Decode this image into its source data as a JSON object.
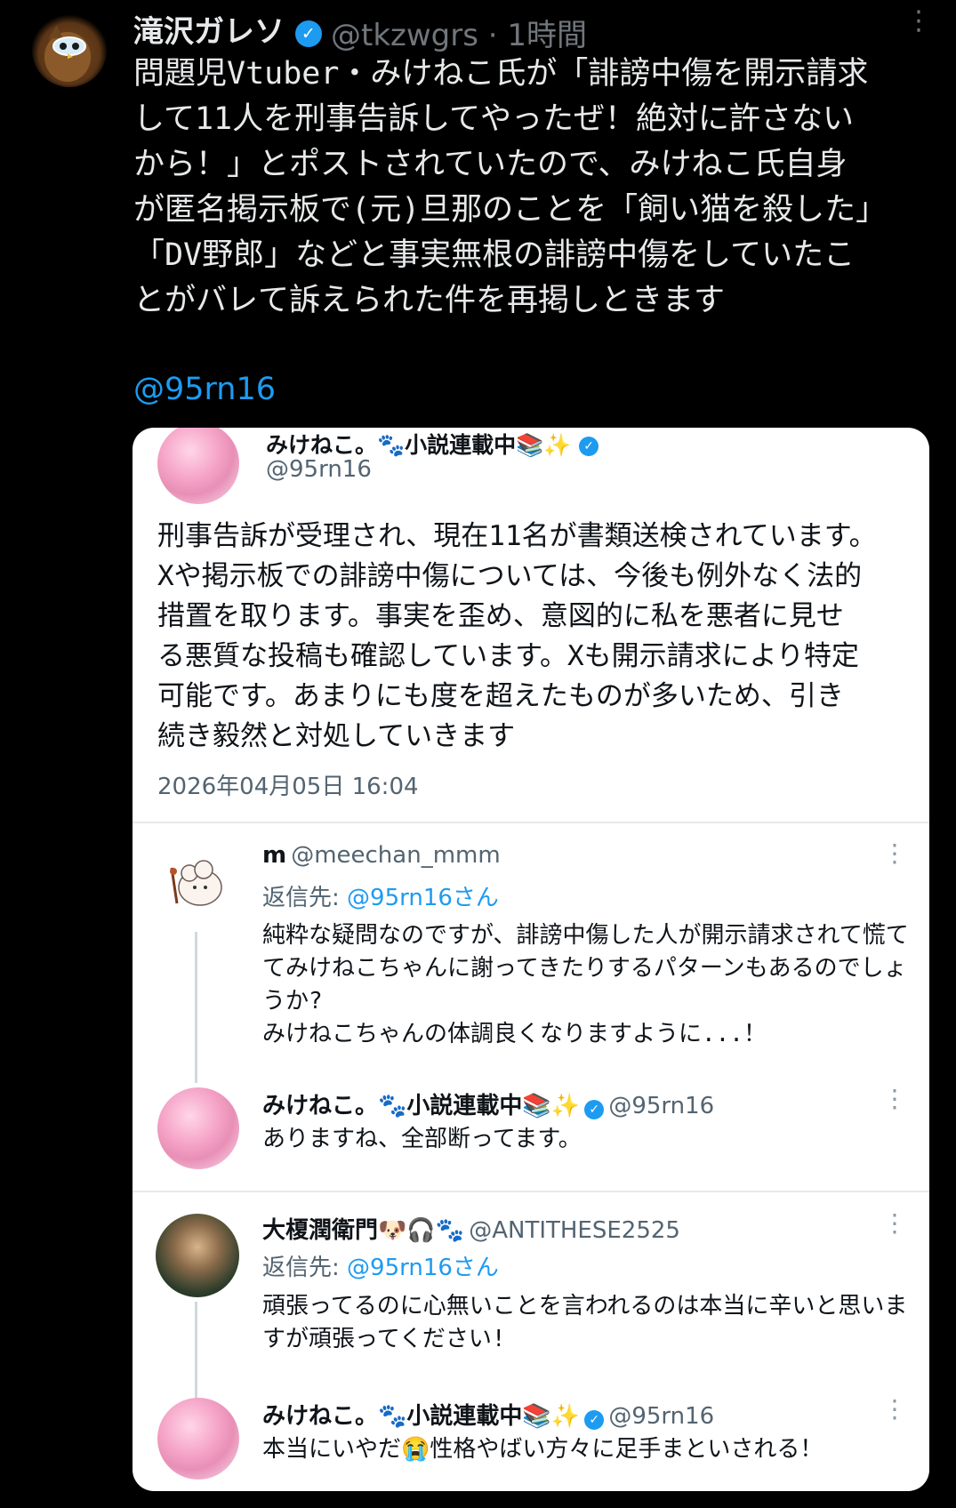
{
  "outer_tweet": {
    "author_name": "滝沢ガレソ",
    "author_handle": "@tkzwgrs",
    "time": "1時間",
    "body": "問題児Vtuber・みけねこ氏が「誹謗中傷を開示請求\nして11人を刑事告訴してやったぜ！絶対に許さない\nから！」とポストされていたので、みけねこ氏自身\nが匿名掲示板で(元)旦那のことを「飼い猫を殺した」\n「DV野郎」などと事実無根の誹謗中傷をしていたこ\nとがバレて訴えられた件を再掲しときます",
    "mention": "@95rn16"
  },
  "quoted": {
    "author_name": "みけねこ。🐾小説連載中📚✨",
    "author_handle": "@95rn16",
    "body": "刑事告訴が受理され、現在11名が書類送検されています。\nXや掲示板での誹謗中傷については、今後も例外なく法的\n措置を取ります。事実を歪め、意図的に私を悪者に見せ\nる悪質な投稿も確認しています。Xも開示請求により特定\n可能です。あまりにも度を超えたものが多いため、引き\n続き毅然と対処していきます",
    "date": "2026年04月05日 16:04"
  },
  "replies": [
    {
      "author_name": "m",
      "author_handle": "@meechan_mmm",
      "reply_to_label": "返信先: ",
      "reply_to": "@95rn16さん",
      "body": "純粋な疑問なのですが、誹謗中傷した人が開示請求されて慌て\nてみけねこちゃんに謝ってきたりするパターンもあるのでしょ\nうか?\nみけねこちゃんの体調良くなりますように...！"
    },
    {
      "author_name": "みけねこ。🐾小説連載中📚✨",
      "author_handle": "@95rn16",
      "body": "ありますね、全部断ってます。"
    },
    {
      "author_name": "大榎潤衛門🐶🎧🐾",
      "author_handle": "@ANTITHESE2525",
      "reply_to_label": "返信先: ",
      "reply_to": "@95rn16さん",
      "body": "頑張ってるのに心無いことを言われるのは本当に辛いと思いま\nすが頑張ってください!"
    },
    {
      "author_name": "みけねこ。🐾小説連載中📚✨",
      "author_handle": "@95rn16",
      "body": "本当にいやだ😭性格やばい方々に足手まといされる！"
    }
  ],
  "icons": {
    "verified": "✓",
    "more": "⋮"
  },
  "colors": {
    "background": "#000000",
    "accent": "#1d9bf0",
    "card": "#ffffff"
  }
}
